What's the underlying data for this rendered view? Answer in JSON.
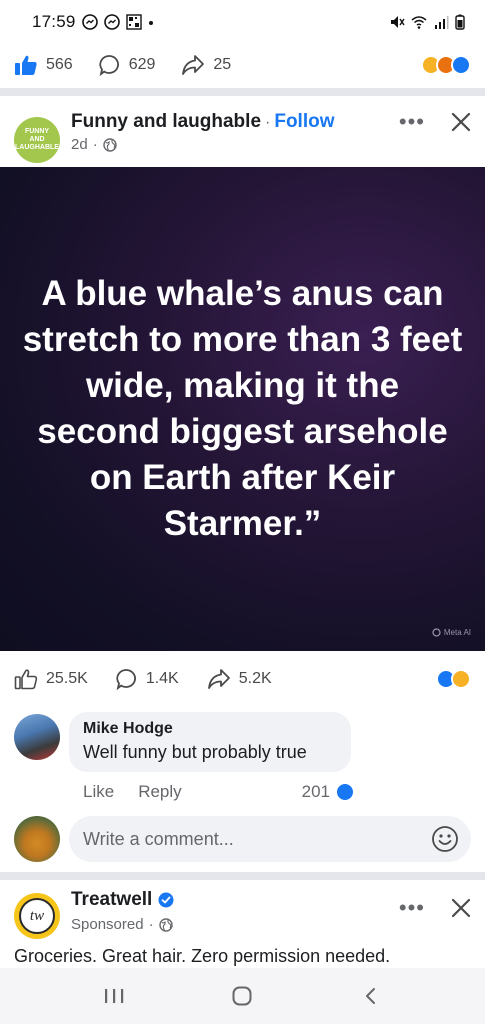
{
  "status_bar": {
    "time": "17:59",
    "icons": [
      "messenger-icon",
      "messenger-icon",
      "qr-icon",
      "dot-icon",
      "mute-icon",
      "wifi-icon",
      "signal-icon",
      "battery-icon"
    ]
  },
  "top_reactions": {
    "likes": "566",
    "comments": "629",
    "shares": "25",
    "emojis": [
      "haha",
      "angry",
      "like"
    ]
  },
  "post": {
    "page_name": "Funny and laughable",
    "follow_label": "Follow",
    "age": "2d",
    "avatar_text": [
      "FUNNY",
      "AND",
      "LAUGHABLE"
    ],
    "image_text": "A blue whale’s anus can stretch to more than 3 feet wide, making it the second biggest arsehole on Earth after Keir Starmer.”",
    "watermark": "Meta AI"
  },
  "post_reactions": {
    "likes": "25.5K",
    "comments": "1.4K",
    "shares": "5.2K",
    "emojis": [
      "like",
      "haha"
    ]
  },
  "comment": {
    "author": "Mike Hodge",
    "text": "Well funny but probably true",
    "like_label": "Like",
    "reply_label": "Reply",
    "like_count": "201"
  },
  "write_comment": {
    "placeholder": "Write a comment..."
  },
  "ad": {
    "name": "Treatwell",
    "avatar_text": "tw",
    "sponsored_label": "Sponsored",
    "caption": "Groceries. Great hair. Zero permission needed."
  },
  "colors": {
    "facebook_blue": "#1877f2",
    "text_primary": "#1c1e21",
    "text_secondary": "#65676b",
    "bubble_bg": "#f0f2f5"
  }
}
